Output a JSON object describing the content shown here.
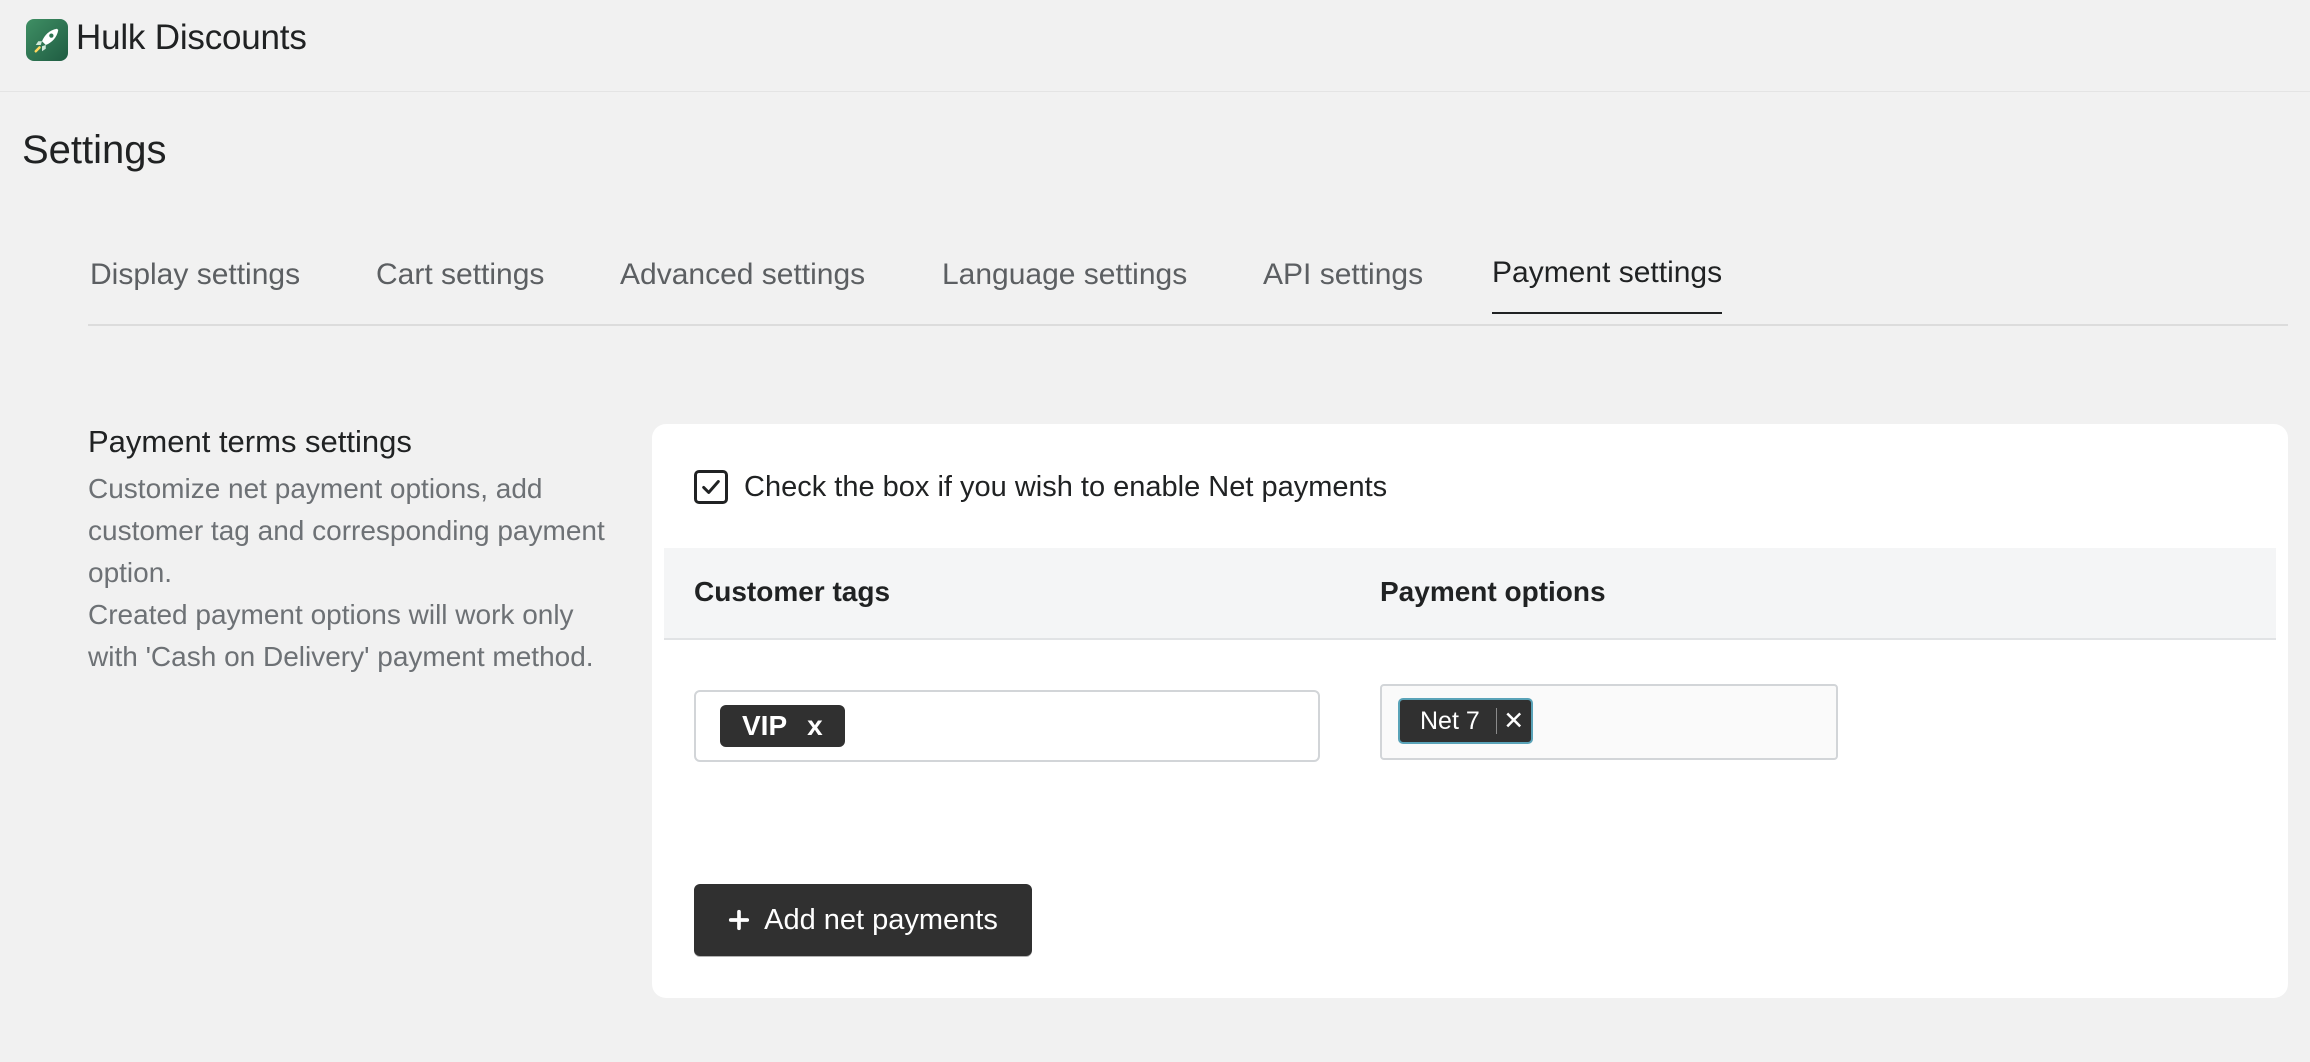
{
  "app": {
    "title": "Hulk Discounts",
    "logo_icon": "rocket-icon",
    "logo_color": "#2e7551"
  },
  "page": {
    "title": "Settings"
  },
  "tabs": [
    {
      "label": "Display settings",
      "active": false
    },
    {
      "label": "Cart settings",
      "active": false
    },
    {
      "label": "Advanced settings",
      "active": false
    },
    {
      "label": "Language settings",
      "active": false
    },
    {
      "label": "API settings",
      "active": false
    },
    {
      "label": "Payment settings",
      "active": true
    }
  ],
  "section": {
    "heading": "Payment terms settings",
    "desc1": "Customize net payment options, add customer tag and corresponding payment option.",
    "desc2": "Created payment options will work only with 'Cash on Delivery' payment method."
  },
  "card": {
    "checkbox_label": "Check the box if you wish to enable Net payments",
    "checkbox_checked": true,
    "columns": [
      "Customer tags",
      "Payment options"
    ],
    "rows": [
      {
        "customer_tag": "VIP",
        "customer_tag_remove": "x",
        "payment_option": "Net 7",
        "payment_option_remove": "✕"
      }
    ],
    "add_button_label": "Add net payments"
  },
  "colors": {
    "background": "#f1f1f1",
    "card": "#ffffff",
    "primary_button": "#303030",
    "chip_focus_border": "#5aa3b8",
    "muted_text": "#6d7175"
  }
}
